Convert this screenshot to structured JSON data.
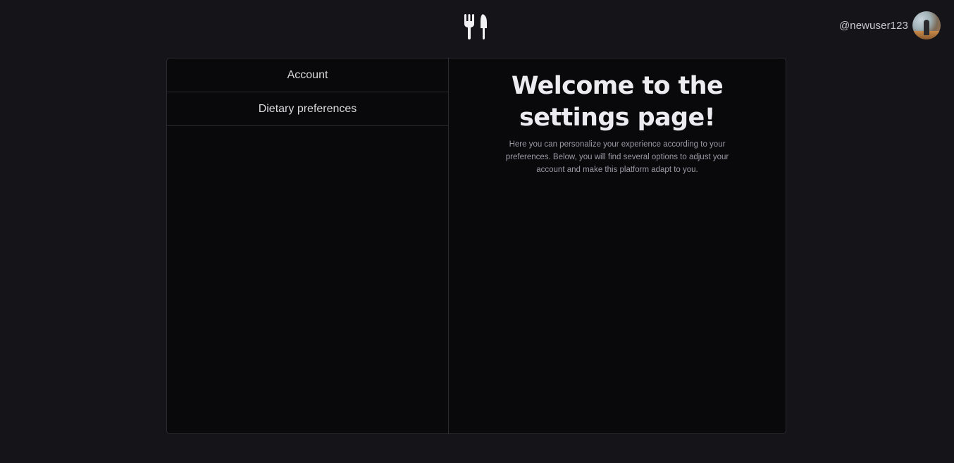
{
  "header": {
    "logo_icon": "fork-knife-icon",
    "username": "@newuser123",
    "avatar_icon": "user-avatar-photo"
  },
  "sidebar": {
    "items": [
      {
        "label": "Account"
      },
      {
        "label": "Dietary preferences"
      }
    ]
  },
  "main": {
    "title": "Welcome to the settings page!",
    "description": "Here you can personalize your experience according to your preferences. Below, you will find several options to adjust your account and make this platform adapt to you."
  },
  "colors": {
    "background": "#151419",
    "panel": "#09090c",
    "border": "#2b2b31",
    "text": "#e6e6ea",
    "muted": "#9b9aa5"
  }
}
